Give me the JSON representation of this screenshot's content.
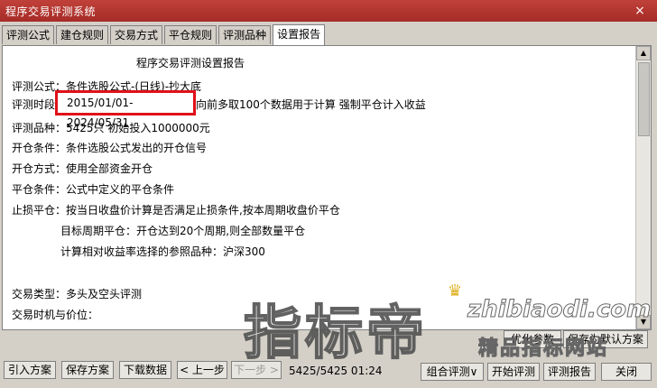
{
  "window": {
    "title": "程序交易评测系统",
    "close_glyph": "×"
  },
  "tabs": [
    "评测公式",
    "建仓规则",
    "交易方式",
    "平仓规则",
    "评测品种",
    "设置报告"
  ],
  "report": {
    "title": "程序交易评测设置报告",
    "formula": "评测公式：条件选股公式-(日线)-抄大底",
    "period_label": "评测时段",
    "period_value": "2015/01/01-2024/05/31",
    "period_rest": "向前多取100个数据用于计算 强制平仓计入收益",
    "variety": "评测品种：5425只 初始投入1000000元",
    "open_cond": "开仓条件：条件选股公式发出的开仓信号",
    "open_mode": "开仓方式：使用全部资金开仓",
    "close_cond": "平仓条件：公式中定义的平仓条件",
    "stop_loss": "止损平仓：按当日收盘价计算是否满足止损条件,按本周期收盘价平仓",
    "target_period": "目标周期平仓：开仓达到20个周期,则全部数量平仓",
    "benchmark": "计算相对收益率选择的参照品种：沪深300",
    "trade_type": "交易类型：多头及空头评测",
    "trade_timing": "交易时机与价位："
  },
  "watermark": {
    "main": "指标帝",
    "url": "zhibiaodi.com",
    "sub": "精品指标网站"
  },
  "buttons": {
    "optimize_params": "优化参数",
    "save_default": "保存为默认方案",
    "import_plan": "引入方案",
    "save_plan": "保存方案",
    "download_data": "下载数据",
    "prev_step": "< 上一步",
    "next_step": "下一步 >",
    "combo_eval": "组合评测∨",
    "start_eval": "开始评测",
    "eval_report": "评测报告",
    "close": "关闭"
  },
  "status": {
    "counter": "5425/5425 01:24"
  }
}
